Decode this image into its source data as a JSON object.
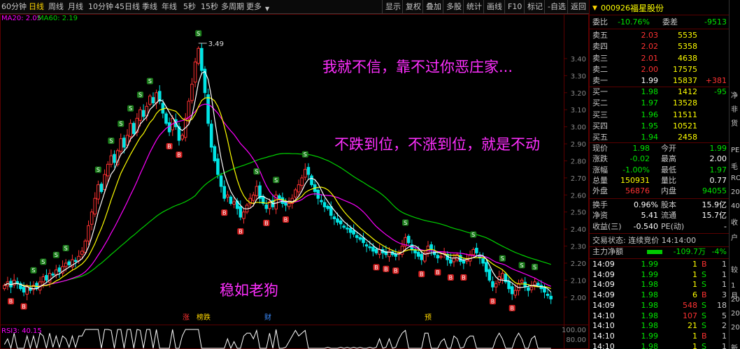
{
  "toolbar": {
    "left_items": [
      "60分钟",
      "日线",
      "周线",
      "月线",
      "10分钟",
      "45日线",
      "季线",
      "年线",
      "5秒",
      "15秒",
      "多周期",
      "更多"
    ],
    "active_index": 1,
    "right_items": [
      "显示",
      "复权",
      "叠加",
      "多股",
      "统计",
      "画线",
      "F10",
      "标记",
      "-自选",
      "返回"
    ]
  },
  "ma_legend": {
    "ma20": "MA20: 2.05",
    "ma60": "MA60: 2.19"
  },
  "rsi_label": "RSI3: 40.15",
  "rsi_axis": [
    "100.00",
    "80.00"
  ],
  "max_price_label": "3.49",
  "annotations": {
    "text1": "我就不信，靠不过你恶庄家...",
    "text2": "不跌到位，不涨到位，就是不动",
    "text3": "稳如老狗"
  },
  "event_markers": [
    "涨",
    "榜跌",
    "财",
    "预"
  ],
  "chart_data": {
    "type": "candlestick",
    "title": "",
    "ylim": [
      1.86,
      3.58
    ],
    "y_ticks": [
      3.4,
      3.3,
      3.2,
      3.1,
      3.0,
      2.9,
      2.8,
      2.7,
      2.6,
      2.5,
      2.4,
      2.3,
      2.2,
      2.1,
      2.0
    ],
    "y_tick_labels": [
      "3.40",
      "3.30",
      "3.20",
      "3.10",
      "3.00",
      "2.90",
      "2.80",
      "2.70",
      "2.60",
      "2.50",
      "2.40",
      "2.30",
      "2.20",
      "2.10",
      "2.00"
    ],
    "close": [
      2.07,
      2.09,
      2.06,
      2.1,
      2.08,
      2.05,
      2.03,
      2.06,
      2.04,
      2.07,
      2.05,
      2.09,
      2.12,
      2.1,
      2.14,
      2.13,
      2.16,
      2.15,
      2.18,
      2.2,
      2.19,
      2.22,
      2.21,
      2.24,
      2.27,
      2.33,
      2.42,
      2.5,
      2.58,
      2.66,
      2.62,
      2.72,
      2.78,
      2.83,
      2.79,
      2.86,
      2.93,
      2.88,
      2.95,
      3.02,
      2.96,
      3.05,
      3.1,
      3.06,
      3.12,
      3.18,
      3.14,
      3.2,
      3.15,
      3.08,
      3.02,
      2.97,
      3.05,
      3.0,
      2.92,
      2.95,
      3.05,
      3.15,
      3.25,
      3.38,
      3.46,
      3.33,
      3.2,
      3.02,
      2.88,
      2.8,
      2.72,
      2.65,
      2.58,
      2.6,
      2.55,
      2.56,
      2.52,
      2.47,
      2.5,
      2.54,
      2.58,
      2.6,
      2.65,
      2.58,
      2.55,
      2.52,
      2.56,
      2.53,
      2.6,
      2.58,
      2.55,
      2.54,
      2.55,
      2.58,
      2.63,
      2.66,
      2.7,
      2.75,
      2.72,
      2.66,
      2.62,
      2.58,
      2.56,
      2.53,
      2.52,
      2.48,
      2.46,
      2.44,
      2.43,
      2.41,
      2.4,
      2.38,
      2.37,
      2.35,
      2.34,
      2.32,
      2.3,
      2.29,
      2.27,
      2.26,
      2.28,
      2.26,
      2.25,
      2.27,
      2.25,
      2.24,
      2.26,
      2.3,
      2.35,
      2.32,
      2.28,
      2.26,
      2.24,
      2.22,
      2.26,
      2.3,
      2.28,
      2.25,
      2.23,
      2.24,
      2.26,
      2.22,
      2.2,
      2.23,
      2.25,
      2.21,
      2.2,
      2.22,
      2.25,
      2.28,
      2.26,
      2.23,
      2.2,
      2.15,
      2.1,
      2.06,
      2.08,
      2.12,
      2.14,
      2.09,
      2.05,
      2.02,
      2.04,
      2.08,
      2.1,
      2.06,
      2.04,
      2.06,
      2.09,
      2.07,
      2.05,
      2.03,
      2.01,
      1.99
    ]
  },
  "quote": {
    "stock_code": "000926",
    "stock_name": "福星股份",
    "weibi_label": "委比",
    "weibi_value": "-10.76%",
    "weicha_label": "委差",
    "weicha_value": "-9513",
    "asks": [
      {
        "label": "卖五",
        "price": "2.03",
        "vol": "5535",
        "chg": ""
      },
      {
        "label": "卖四",
        "price": "2.02",
        "vol": "5358",
        "chg": ""
      },
      {
        "label": "卖三",
        "price": "2.01",
        "vol": "4638",
        "chg": ""
      },
      {
        "label": "卖二",
        "price": "2.00",
        "vol": "17575",
        "chg": ""
      },
      {
        "label": "卖一",
        "price": "1.99",
        "vol": "15837",
        "chg": "+381"
      }
    ],
    "bids": [
      {
        "label": "买一",
        "price": "1.98",
        "vol": "1412",
        "chg": "-95"
      },
      {
        "label": "买二",
        "price": "1.97",
        "vol": "13528",
        "chg": ""
      },
      {
        "label": "买三",
        "price": "1.96",
        "vol": "11511",
        "chg": ""
      },
      {
        "label": "买四",
        "price": "1.95",
        "vol": "10521",
        "chg": ""
      },
      {
        "label": "买五",
        "price": "1.94",
        "vol": "2458",
        "chg": ""
      }
    ],
    "stats": [
      {
        "l1": "现价",
        "v1": "1.98",
        "l2": "今开",
        "v2": "1.99"
      },
      {
        "l1": "涨跌",
        "v1": "-0.02",
        "l2": "最高",
        "v2": "2.00"
      },
      {
        "l1": "涨幅",
        "v1": "-1.00%",
        "l2": "最低",
        "v2": "1.97"
      },
      {
        "l1": "总量",
        "v1": "150931",
        "l2": "量比",
        "v2": "0.77"
      },
      {
        "l1": "外盘",
        "v1": "56876",
        "l2": "内盘",
        "v2": "94055"
      }
    ],
    "stats2": [
      {
        "l1": "换手",
        "v1": "0.96%",
        "l2": "股本",
        "v2": "15.9亿"
      },
      {
        "l1": "净资",
        "v1": "5.41",
        "l2": "流通",
        "v2": "15.7亿"
      },
      {
        "l1": "收益(三)",
        "v1": "-0.540",
        "l2": "PE(动)",
        "v2": "-"
      }
    ],
    "trade_status_label": "交易状态: 连续竞价 14:14:00",
    "main_flow_label": "主力净额",
    "main_flow_value": "-109.7万",
    "main_flow_pct": "-4%",
    "ticks": [
      {
        "time": "14:09",
        "price": "1.99",
        "vol": "1",
        "side": "B",
        "n": "1"
      },
      {
        "time": "14:09",
        "price": "1.99",
        "vol": "1",
        "side": "S",
        "n": "1"
      },
      {
        "time": "14:09",
        "price": "1.98",
        "vol": "1",
        "side": "S",
        "n": "1"
      },
      {
        "time": "14:09",
        "price": "1.98",
        "vol": "6",
        "side": "B",
        "n": "3"
      },
      {
        "time": "14:09",
        "price": "1.98",
        "vol": "548",
        "side": "S",
        "n": "18"
      },
      {
        "time": "14:10",
        "price": "1.98",
        "vol": "107",
        "side": "S",
        "n": "5"
      },
      {
        "time": "14:10",
        "price": "1.98",
        "vol": "21",
        "side": "S",
        "n": "2"
      },
      {
        "time": "14:10",
        "price": "1.99",
        "vol": "1",
        "side": "B",
        "n": "1"
      },
      {
        "time": "14:10",
        "price": "1.98",
        "vol": "1",
        "side": "S",
        "n": "1"
      }
    ]
  },
  "side_strip": [
    "净",
    "非",
    "货",
    "PE",
    "毛",
    "ROE",
    "20",
    "40",
    "收",
    "户",
    "较",
    "1月",
    "20",
    "20",
    "20",
    "新"
  ],
  "colors": {
    "up": "#ff3232",
    "down": "#00e5e5",
    "ma5": "#ffffff",
    "ma10": "#ffff00",
    "ma20": "#ff00ff",
    "ma60": "#00d200",
    "annotation": "#ff2fff",
    "grid": "#5a0000"
  }
}
